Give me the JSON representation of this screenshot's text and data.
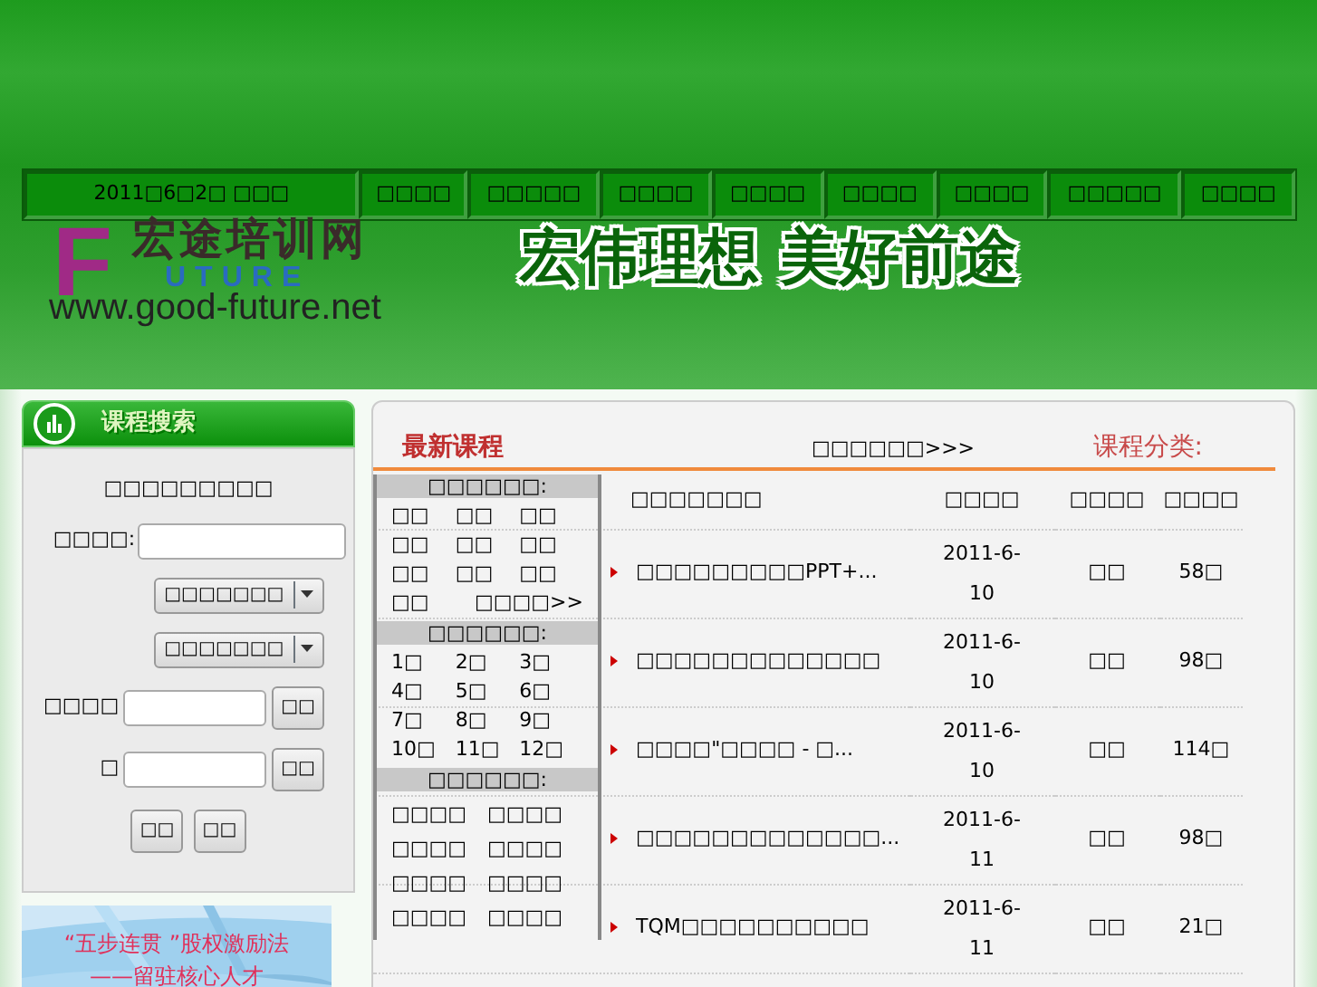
{
  "nav": {
    "date": "2011□6□2□ □□□",
    "items": [
      {
        "label": "□□□□"
      },
      {
        "label": "□□□□□"
      },
      {
        "label": "□□□□"
      },
      {
        "label": "□□□□"
      },
      {
        "label": "□□□□"
      },
      {
        "label": "□□□□"
      },
      {
        "label": "□□□□□"
      },
      {
        "label": "□□□□"
      }
    ]
  },
  "logo": {
    "name": "宏途培训网",
    "letter": "F",
    "rest": "UTURE",
    "url": "www.good-future.net"
  },
  "slogan": "宏伟理想 美好前途",
  "search_panel": {
    "title": "课程搜索",
    "heading": "□□□□□□□□□",
    "keyword_label": "□□□□:",
    "selects": [
      "□□□□□□□",
      "□□□□□□□"
    ],
    "from_label": "□□□□",
    "to_label": "□",
    "pick_buttons": [
      "□□",
      "□□"
    ],
    "buttons": [
      "□□",
      "□□"
    ]
  },
  "ad": {
    "kind": "picture",
    "lines": [
      "“五步连贯 ”股权激励法",
      "——留驻核心人才"
    ]
  },
  "courses": {
    "title": "最新课程",
    "more": "□□□□□□>>>",
    "category_title": "课程分类:",
    "columns": [
      "□□□□□□□",
      "□□□□",
      "□□□□",
      "□□□□"
    ],
    "rows": [
      {
        "title": "□□□□□□□□□PPT+...",
        "date": "2011-6-10",
        "type": "□□",
        "hours": "58□"
      },
      {
        "title": "□□□□□□□□□□□□□",
        "date": "2011-6-10",
        "type": "□□",
        "hours": "98□"
      },
      {
        "title": "□□□□\"□□□□ - □...",
        "date": "2011-6-10",
        "type": "□□",
        "hours": "114□"
      },
      {
        "title": "□□□□□□□□□□□□□...",
        "date": "2011-6-11",
        "type": "□□",
        "hours": "98□"
      },
      {
        "title": "TQM□□□□□□□□□□",
        "date": "2011-6-11",
        "type": "□□",
        "hours": "21□"
      }
    ]
  },
  "category_popup": {
    "sections": [
      {
        "kind": "grid3",
        "title": "□□□□□□:",
        "items": [
          "□□",
          "□□",
          "□□",
          "□□",
          "□□",
          "□□",
          "□□",
          "□□",
          "□□",
          "□□"
        ],
        "more": "□□□□>>"
      },
      {
        "kind": "grid3",
        "title": "□□□□□□:",
        "items": [
          "1□",
          "2□",
          "3□",
          "4□",
          "5□",
          "6□",
          "7□",
          "8□",
          "9□",
          "10□",
          "11□",
          "12□"
        ]
      },
      {
        "kind": "grid2",
        "title": "□□□□□□:",
        "items": [
          "□□□□",
          "□□□□",
          "□□□□",
          "□□□□",
          "□□□□",
          "□□□□",
          "□□□□",
          "□□□□"
        ]
      }
    ]
  }
}
